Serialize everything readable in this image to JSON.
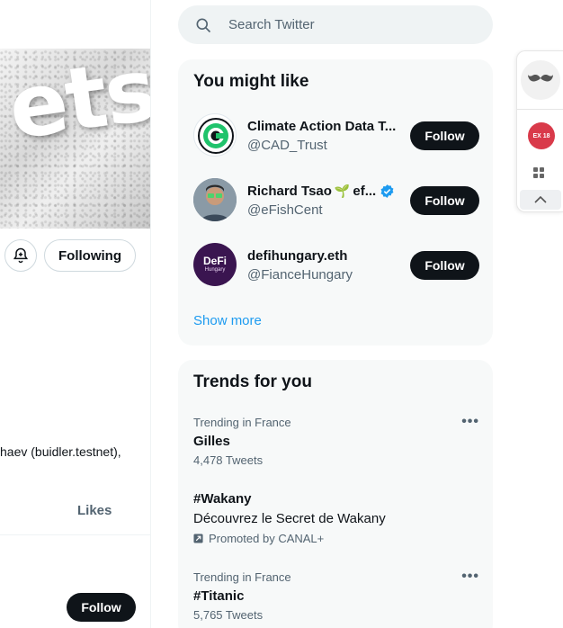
{
  "profile": {
    "banner_text": "ets",
    "following_label": "Following",
    "bio_fragment": "haev (buidler.testnet),",
    "likes_tab": "Likes",
    "follow_label": "Follow"
  },
  "search": {
    "placeholder": "Search Twitter"
  },
  "who_to_follow": {
    "title": "You might like",
    "users": [
      {
        "name": "Climate Action Data T...",
        "handle": "@CAD_Trust",
        "follow": "Follow",
        "avatar": "cad-trust-logo"
      },
      {
        "name_part1": "Richard Tsao",
        "sprout": "🌱",
        "name_part2": "ef...",
        "handle": "@eFishCent",
        "follow": "Follow",
        "verified": true
      },
      {
        "name": "defihungary.eth",
        "handle": "@FianceHungary",
        "follow": "Follow",
        "avatar_label_1": "DeFi",
        "avatar_label_2": "Hungary"
      }
    ],
    "show_more": "Show more"
  },
  "trends": {
    "title": "Trends for you",
    "items": [
      {
        "meta": "Trending in France",
        "name": "Gilles",
        "count": "4,478 Tweets"
      },
      {
        "name": "#Wakany",
        "description": "Découvrez le Secret de Wakany",
        "promoted": "Promoted by CANAL+"
      },
      {
        "meta": "Trending in France",
        "name": "#Titanic",
        "count": "5,765 Tweets"
      }
    ]
  },
  "extension": {
    "badge_text": "EX 18"
  },
  "colors": {
    "accent": "#1d9bf0",
    "follow_bg": "#0f1419",
    "card_bg": "#f7f9f9"
  }
}
